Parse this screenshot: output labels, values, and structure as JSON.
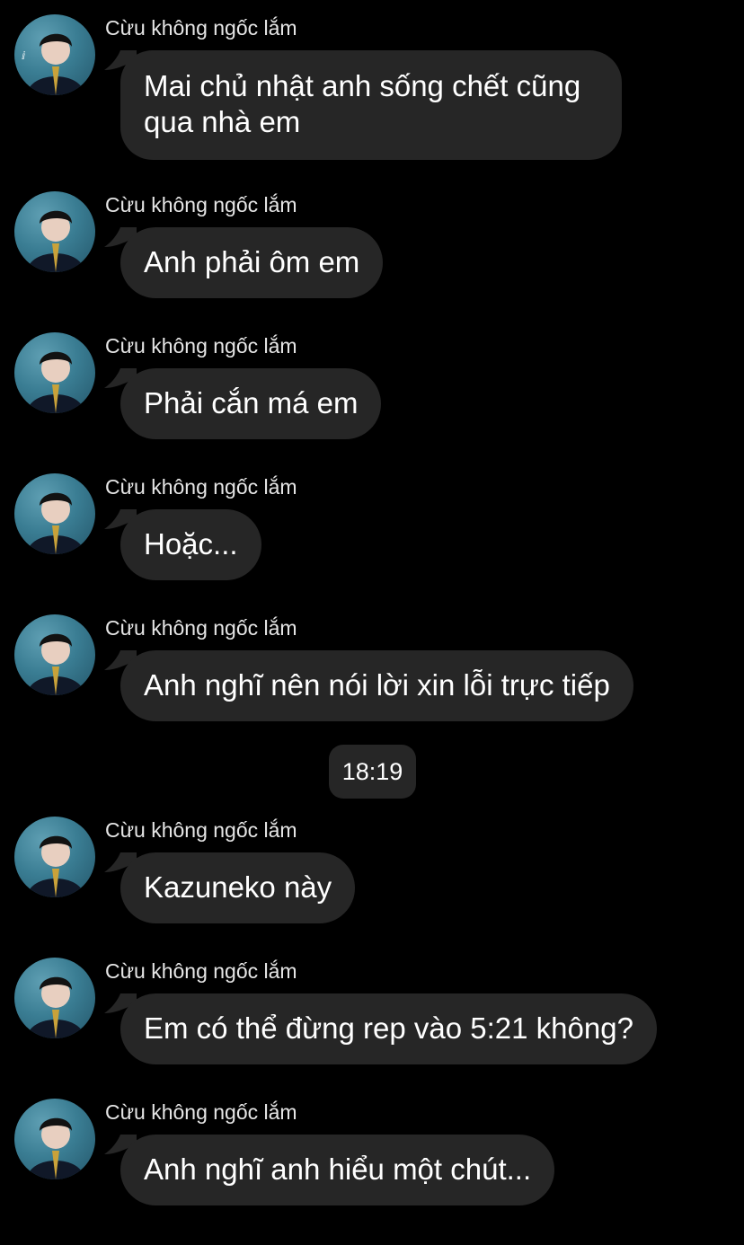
{
  "chat": {
    "sender_name": "Cừu không ngốc lắm",
    "timestamp": "18:19",
    "messages": [
      {
        "sender": "Cừu không ngốc lắm",
        "text": "Mai chủ nhật anh sống chết cũng qua nhà em"
      },
      {
        "sender": "Cừu không ngốc lắm",
        "text": "Anh phải ôm em"
      },
      {
        "sender": "Cừu không ngốc lắm",
        "text": "Phải cắn má em"
      },
      {
        "sender": "Cừu không ngốc lắm",
        "text": "Hoặc..."
      },
      {
        "sender": "Cừu không ngốc lắm",
        "text": "Anh nghĩ nên nói lời xin lỗi trực tiếp"
      },
      {
        "sender": "Cừu không ngốc lắm",
        "text": "Kazuneko này"
      },
      {
        "sender": "Cừu không ngốc lắm",
        "text": "Em có thể đừng rep vào 5:21 không?"
      },
      {
        "sender": "Cừu không ngốc lắm",
        "text": "Anh nghĩ anh hiểu một chút..."
      }
    ]
  },
  "colors": {
    "background": "#000000",
    "bubble": "#262626",
    "text": "#ffffff",
    "sender_text": "#e6e6e6"
  },
  "icons": {
    "avatar": "profile-photo-avatar"
  }
}
